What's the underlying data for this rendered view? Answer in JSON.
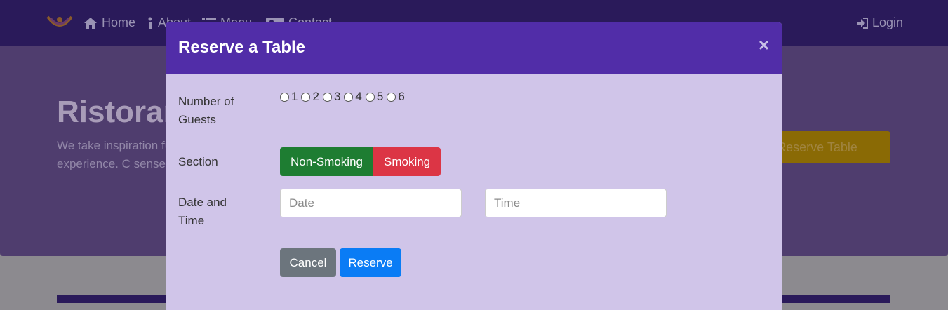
{
  "navbar": {
    "home": "Home",
    "about": "About",
    "menu": "Menu",
    "contact": "Contact",
    "login": "Login"
  },
  "hero": {
    "title": "Ristorante",
    "text": "We take inspiration fusion experience. C senses!",
    "button": "Reserve Table"
  },
  "modal": {
    "title": "Reserve a Table",
    "close": "×",
    "guests_label": "Number of Guests",
    "guest_options": [
      "1",
      "2",
      "3",
      "4",
      "5",
      "6"
    ],
    "section_label": "Section",
    "non_smoking": "Non-Smoking",
    "smoking": "Smoking",
    "datetime_label": "Date and Time",
    "date_placeholder": "Date",
    "time_placeholder": "Time",
    "cancel": "Cancel",
    "reserve": "Reserve"
  },
  "colors": {
    "modal_header": "#512da8",
    "modal_body": "#d0c5e9",
    "non_smoking": "#1e7d32",
    "smoking": "#dc3545",
    "cancel": "#6c757d",
    "reserve": "#0a7cf5"
  },
  "icons": {
    "home": "home-icon",
    "about": "info-icon",
    "menu": "list-icon",
    "contact": "address-card-icon",
    "login": "sign-in-icon"
  }
}
